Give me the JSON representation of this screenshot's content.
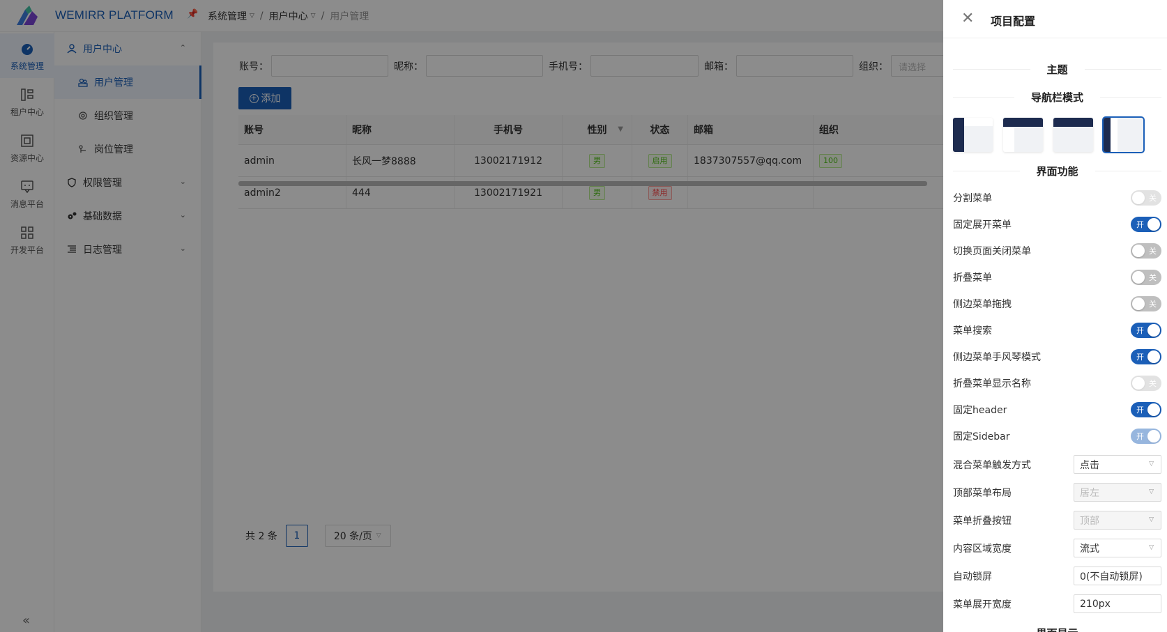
{
  "header": {
    "brand": "WEMIRR PLATFORM",
    "breadcrumb": [
      "系统管理",
      "用户中心",
      "用户管理"
    ]
  },
  "rail": [
    {
      "label": "系统管理",
      "icon": "dashboard-icon",
      "active": true
    },
    {
      "label": "租户中心",
      "icon": "tenant-icon",
      "active": false
    },
    {
      "label": "资源中心",
      "icon": "resource-icon",
      "active": false
    },
    {
      "label": "消息平台",
      "icon": "message-icon",
      "active": false
    },
    {
      "label": "开发平台",
      "icon": "dev-grid-icon",
      "active": false
    }
  ],
  "sidebar": {
    "group": "用户中心",
    "sub": [
      "用户管理",
      "组织管理",
      "岗位管理"
    ],
    "groups": [
      "权限管理",
      "基础数据",
      "日志管理"
    ]
  },
  "search": {
    "fields": [
      {
        "label": "账号：",
        "placeholder": ""
      },
      {
        "label": "昵称：",
        "placeholder": ""
      },
      {
        "label": "手机号：",
        "placeholder": ""
      },
      {
        "label": "邮箱：",
        "placeholder": ""
      },
      {
        "label": "组织：",
        "placeholder": "请选择"
      }
    ]
  },
  "toolbar": {
    "add_label": "添加"
  },
  "table": {
    "headers": [
      "账号",
      "昵称",
      "手机号",
      "性别",
      "状态",
      "邮箱",
      "组织"
    ],
    "rows": [
      {
        "account": "admin",
        "nickname": "长风一梦8888",
        "phone": "13002171912",
        "gender": "男",
        "status": "启用",
        "email": "1837307557@qq.com",
        "org": "100"
      },
      {
        "account": "admin2",
        "nickname": "444",
        "phone": "13002171921",
        "gender": "男",
        "status": "禁用",
        "email": "",
        "org": ""
      }
    ]
  },
  "pager": {
    "total": "共 2 条",
    "page": "1",
    "size": "20 条/页"
  },
  "drawer": {
    "title": "项目配置",
    "section_theme": "主题",
    "section_nav": "导航栏模式",
    "section_features": "界面功能",
    "section_display": "界面显示",
    "switches": [
      {
        "label": "分割菜单",
        "state": "关",
        "on": false,
        "disabled": true
      },
      {
        "label": "固定展开菜单",
        "state": "开",
        "on": true,
        "disabled": false
      },
      {
        "label": "切换页面关闭菜单",
        "state": "关",
        "on": false,
        "disabled": false
      },
      {
        "label": "折叠菜单",
        "state": "关",
        "on": false,
        "disabled": false
      },
      {
        "label": "侧边菜单拖拽",
        "state": "关",
        "on": false,
        "disabled": false
      },
      {
        "label": "菜单搜索",
        "state": "开",
        "on": true,
        "disabled": false
      },
      {
        "label": "侧边菜单手风琴模式",
        "state": "开",
        "on": true,
        "disabled": false
      },
      {
        "label": "折叠菜单显示名称",
        "state": "关",
        "on": false,
        "disabled": true
      },
      {
        "label": "固定header",
        "state": "开",
        "on": true,
        "disabled": false
      },
      {
        "label": "固定Sidebar",
        "state": "开",
        "on": true,
        "disabled": true
      }
    ],
    "selects": [
      {
        "label": "混合菜单触发方式",
        "value": "点击",
        "disabled": false
      },
      {
        "label": "顶部菜单布局",
        "value": "居左",
        "disabled": true
      },
      {
        "label": "菜单折叠按钮",
        "value": "顶部",
        "disabled": true
      },
      {
        "label": "内容区域宽度",
        "value": "流式",
        "disabled": false
      }
    ],
    "inputs": [
      {
        "label": "自动锁屏",
        "value": "0(不自动锁屏)"
      },
      {
        "label": "菜单展开宽度",
        "value": "210px"
      }
    ]
  },
  "colors": {
    "primary": "#1b5fb8",
    "nav_dark": "#1d2b4f",
    "success": "#52c41a",
    "danger": "#ff4d4f"
  }
}
